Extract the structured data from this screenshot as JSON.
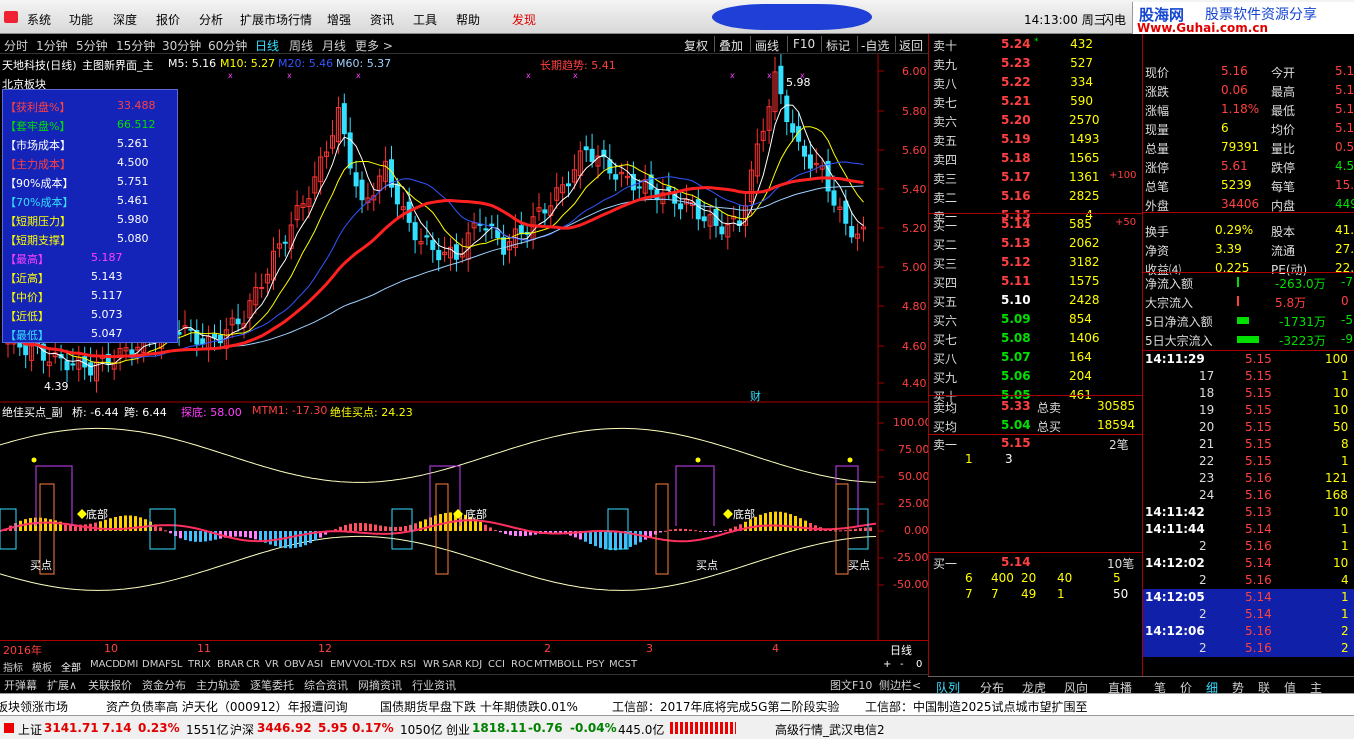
{
  "menu": {
    "items": [
      "系统",
      "功能",
      "深度",
      "报价",
      "分析",
      "扩展市场行情",
      "增强",
      "资讯",
      "工具",
      "帮助"
    ],
    "discover": "发现",
    "clock": "14:13:00 周三",
    "flash": "闪电"
  },
  "brand": {
    "line1": "股海网",
    "line2": "股票软件资源分享",
    "url": "Www.Guhai.com.cn"
  },
  "toolbar": {
    "left": [
      "分时",
      "1分钟",
      "5分钟",
      "15分钟",
      "30分钟",
      "60分钟",
      "日线",
      "周线",
      "月线",
      "更多 >"
    ],
    "active_index": 6,
    "right": [
      "复权",
      "叠加",
      "画线",
      "F10",
      "标记",
      "-自选",
      "返回"
    ]
  },
  "main": {
    "title": "天地科技(日线)",
    "layout": "主图新界面_主",
    "m5": "M5: 5.16",
    "m10": "M10: 5.27",
    "m20": "M20: 5.46",
    "m60": "M60: 5.37",
    "trend": "长期趋势: 5.41",
    "board": "北京板块",
    "high_label": "5.98",
    "low_label": "4.39",
    "cai": "财",
    "yaxis": [
      "6.00",
      "5.80",
      "5.60",
      "5.40",
      "5.20",
      "5.00",
      "4.80",
      "4.60",
      "4.40"
    ],
    "colors": {
      "up": "#ff3333",
      "down": "#33e0ff",
      "ma5": "#ffffff",
      "ma10": "#ffff00",
      "ma20": "#3355ff",
      "ma60": "#a0d0ff",
      "trend": "#ff2020"
    }
  },
  "infobox": {
    "rows": [
      {
        "label": "【获利盘%】",
        "value": "33.488",
        "color": "#ff4040"
      },
      {
        "label": "【套牢盘%】",
        "value": "66.512",
        "color": "#00e000"
      },
      {
        "label": "【市场成本】",
        "value": "5.261",
        "color": "#ffffff"
      },
      {
        "label": "【主力成本】",
        "value": "4.500",
        "color": "#ff4040"
      },
      {
        "label": "【90%成本】",
        "value": "5.751",
        "color": "#ffffff"
      },
      {
        "label": "【70%成本】",
        "value": "5.461",
        "color": "#33e0ff"
      },
      {
        "label": "【短期压力】",
        "value": "5.980",
        "color": "#ffff00"
      },
      {
        "label": "【短期支撑】",
        "value": "5.080",
        "color": "#ffff00"
      },
      {
        "label": "【最高】",
        "value": "5.187",
        "color": "#ff40ff"
      },
      {
        "label": "【近高】",
        "value": "5.143",
        "color": "#ffff00"
      },
      {
        "label": "【中价】",
        "value": "5.117",
        "color": "#ffff00"
      },
      {
        "label": "【近低】",
        "value": "5.073",
        "color": "#ffff00"
      },
      {
        "label": "【最低】",
        "value": "5.047",
        "color": "#33e0ff"
      }
    ]
  },
  "sub": {
    "title": "绝佳买点_副",
    "qiao": "桥: -6.44",
    "kua": "跨: 6.44",
    "tandi": "探底: 58.00",
    "mtm": "MTM1: -17.30",
    "jjmd": "绝佳买点: 24.23",
    "bottom_label": "底部",
    "buy_label": "买点",
    "yaxis": [
      "100.00",
      "75.00",
      "50.00",
      "25.00",
      "0.00",
      "-25.00",
      "-50.00"
    ]
  },
  "xaxis": {
    "labels": [
      "2016年",
      "10",
      "11",
      "12",
      "2",
      "3",
      "4"
    ],
    "period": "日线"
  },
  "tabs1": [
    "指标",
    "模板",
    "全部",
    "MACD",
    "DMI",
    "DMA",
    "FSL",
    "TRIX",
    "BRAR",
    "CR",
    "VR",
    "OBV",
    "ASI",
    "EMV",
    "VOL-TDX",
    "RSI",
    "WR",
    "SAR",
    "KDJ",
    "CCI",
    "ROC",
    "MTM",
    "BOLL",
    "PSY",
    "MCST"
  ],
  "tabs1_right": [
    "+",
    "-",
    "0"
  ],
  "tabs2": [
    "开弹幕",
    "扩展∧",
    "关联报价",
    "资金分布",
    "主力轨迹",
    "逐笔委托",
    "综合资讯",
    "网摘资讯",
    "行业资讯"
  ],
  "tabs2_right": [
    "图文F10",
    "侧边栏<"
  ],
  "orderbook": {
    "sell": [
      {
        "l": "卖十",
        "p": "5.24",
        "v": "432",
        "m": "*"
      },
      {
        "l": "卖九",
        "p": "5.23",
        "v": "527"
      },
      {
        "l": "卖八",
        "p": "5.22",
        "v": "334"
      },
      {
        "l": "卖七",
        "p": "5.21",
        "v": "590"
      },
      {
        "l": "卖六",
        "p": "5.20",
        "v": "2570"
      },
      {
        "l": "卖五",
        "p": "5.19",
        "v": "1493"
      },
      {
        "l": "卖四",
        "p": "5.18",
        "v": "1565"
      },
      {
        "l": "卖三",
        "p": "5.17",
        "v": "1361",
        "d": "+100"
      },
      {
        "l": "卖二",
        "p": "5.16",
        "v": "2825"
      },
      {
        "l": "卖一",
        "p": "5.15",
        "v": "4"
      }
    ],
    "buy": [
      {
        "l": "买一",
        "p": "5.14",
        "v": "585",
        "d": "+50"
      },
      {
        "l": "买二",
        "p": "5.13",
        "v": "2062"
      },
      {
        "l": "买三",
        "p": "5.12",
        "v": "3182"
      },
      {
        "l": "买四",
        "p": "5.11",
        "v": "1575"
      },
      {
        "l": "买五",
        "p": "5.10",
        "v": "2428"
      },
      {
        "l": "买六",
        "p": "5.09",
        "v": "854"
      },
      {
        "l": "买七",
        "p": "5.08",
        "v": "1406"
      },
      {
        "l": "买八",
        "p": "5.07",
        "v": "164"
      },
      {
        "l": "买九",
        "p": "5.06",
        "v": "204"
      },
      {
        "l": "买十",
        "p": "5.05",
        "v": "461"
      }
    ],
    "avg": [
      {
        "l": "卖均",
        "p": "5.33",
        "l2": "总卖",
        "v": "30585"
      },
      {
        "l": "买均",
        "p": "5.04",
        "l2": "总买",
        "v": "18594"
      }
    ],
    "sell1": {
      "l": "卖一",
      "p": "5.15",
      "n": "2笔",
      "q": [
        "1",
        "3"
      ]
    },
    "buy1": {
      "l": "买一",
      "p": "5.14",
      "n": "10笔",
      "q1": [
        "6",
        "400",
        "20",
        "40",
        "5"
      ],
      "q2": [
        "7",
        "7",
        "49",
        "1",
        "50"
      ]
    }
  },
  "quote": [
    {
      "a": "现价",
      "av": "5.16",
      "b": "今开",
      "bv": "5.1"
    },
    {
      "a": "涨跌",
      "av": "0.06",
      "b": "最高",
      "bv": "5.1"
    },
    {
      "a": "涨幅",
      "av": "1.18%",
      "b": "最低",
      "bv": "5.1"
    },
    {
      "a": "现量",
      "av": "6",
      "b": "均价",
      "bv": "5.1"
    },
    {
      "a": "总量",
      "av": "79391",
      "b": "量比",
      "bv": "0.5"
    },
    {
      "a": "涨停",
      "av": "5.61",
      "b": "跌停",
      "bv": "4.5"
    },
    {
      "a": "总笔",
      "av": "5239",
      "b": "每笔",
      "bv": "15."
    },
    {
      "a": "外盘",
      "av": "34406",
      "b": "内盘",
      "bv": "4498"
    },
    {
      "a": "换手",
      "av": "0.29%",
      "b": "股本",
      "bv": "41.4"
    },
    {
      "a": "净资",
      "av": "3.39",
      "b": "流通",
      "bv": "27.7"
    },
    {
      "a": "收益⑷",
      "av": "0.225",
      "b": "PE(动)",
      "bv": "22."
    }
  ],
  "flow": [
    {
      "l": "净流入额",
      "v": "-263.0万",
      "e": "-7"
    },
    {
      "l": "大宗流入",
      "v": "5.8万",
      "e": "0"
    },
    {
      "l": "5日净流入额",
      "v": "-1731万",
      "e": "-5"
    },
    {
      "l": "5日大宗流入",
      "v": "-3223万",
      "e": "-9"
    }
  ],
  "ticks": [
    {
      "t": "14:11:29",
      "p": "5.15",
      "v": "100"
    },
    {
      "t": "17",
      "p": "5.15",
      "v": "1"
    },
    {
      "t": "18",
      "p": "5.15",
      "v": "10"
    },
    {
      "t": "19",
      "p": "5.15",
      "v": "10"
    },
    {
      "t": "20",
      "p": "5.15",
      "v": "50"
    },
    {
      "t": "21",
      "p": "5.15",
      "v": "8"
    },
    {
      "t": "22",
      "p": "5.15",
      "v": "1"
    },
    {
      "t": "23",
      "p": "5.16",
      "v": "121"
    },
    {
      "t": "24",
      "p": "5.16",
      "v": "168"
    },
    {
      "t": "14:11:42",
      "p": "5.13",
      "v": "10"
    },
    {
      "t": "14:11:44",
      "p": "5.14",
      "v": "1"
    },
    {
      "t": "2",
      "p": "5.16",
      "v": "1"
    },
    {
      "t": "14:12:02",
      "p": "5.14",
      "v": "10"
    },
    {
      "t": "2",
      "p": "5.16",
      "v": "4"
    },
    {
      "t": "14:12:05",
      "p": "5.14",
      "v": "1"
    },
    {
      "t": "2",
      "p": "5.14",
      "v": "1"
    },
    {
      "t": "14:12:06",
      "p": "5.16",
      "v": "2"
    },
    {
      "t": "2",
      "p": "5.16",
      "v": "2"
    }
  ],
  "bottomtabs": [
    "队列",
    "分布",
    "龙虎",
    "风向",
    "直播",
    "笔",
    "价",
    "细",
    "势",
    "联",
    "值",
    "主"
  ],
  "ticker": [
    "板块领涨市场",
    "资产负债率高 泸天化（000912）年报遭问询",
    "国债期货早盘下跌 十年期债跌0.01%",
    "工信部：2017年底将完成5G第二阶段实验",
    "工信部：中国制造2025试点城市望扩围至"
  ],
  "status": {
    "sh": "上证",
    "sh_v": "3141.71",
    "sh_c": "7.14",
    "sh_p": "0.23%",
    "sh_a": "1551亿",
    "sz": "沪深",
    "sz_v": "3446.92",
    "sz_c": "5.95",
    "sz_p": "0.17%",
    "sz_a": "1050亿",
    "cy": "创业",
    "cy_v": "1818.11",
    "cy_c": "-0.76",
    "cy_p": "-0.04%",
    "cy_a": "445.0亿",
    "info": "高级行情_武汉电信2"
  }
}
